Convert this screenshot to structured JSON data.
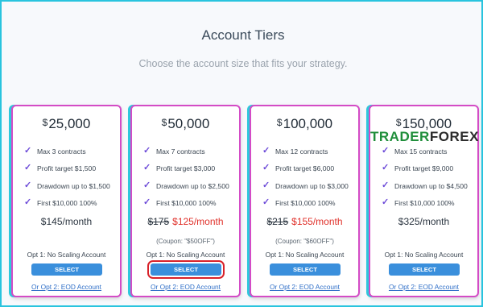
{
  "header": {
    "title": "Account Tiers",
    "subtitle": "Choose the account size that fits your strategy."
  },
  "watermark": {
    "part1": "TRADER",
    "part2": "FOREX"
  },
  "currency_symbol": "$",
  "check_icon": "check-icon",
  "colors": {
    "frame_border": "#29c4de",
    "card_border": "#d44cc6",
    "card_edge": "#2ec8dc",
    "select_button": "#3a8fdc",
    "discount_price": "#e0302a",
    "highlight_ring": "#d8222a",
    "link": "#2f6fc8",
    "check": "#6c4ad8"
  },
  "tiers": [
    {
      "amount": "25,000",
      "features": [
        "Max 3 contracts",
        "Profit target $1,500",
        "Drawdown up to $1,500",
        "First $10,000 100%"
      ],
      "old_price": "",
      "price": "$145/month",
      "coupon": "",
      "opt1": "Opt 1: No Scaling Account",
      "select_label": "SELECT",
      "opt2": "Or Opt 2: EOD Account"
    },
    {
      "amount": "50,000",
      "features": [
        "Max 7 contracts",
        "Profit target $3,000",
        "Drawdown up to $2,500",
        "First $10,000 100%"
      ],
      "old_price": "$175",
      "price": "$125/month",
      "coupon": "(Coupon: \"$50OFF\")",
      "opt1": "Opt 1: No Scaling Account",
      "select_label": "SELECT",
      "opt2": "Or Opt 2: EOD Account"
    },
    {
      "amount": "100,000",
      "features": [
        "Max 12 contracts",
        "Profit target $6,000",
        "Drawdown up to $3,000",
        "First $10,000 100%"
      ],
      "old_price": "$215",
      "price": "$155/month",
      "coupon": "(Coupon: \"$60OFF\")",
      "opt1": "Opt 1: No Scaling Account",
      "select_label": "SELECT",
      "opt2": "Or Opt 2: EOD Account"
    },
    {
      "amount": "150,000",
      "features": [
        "Max 15 contracts",
        "Profit target $9,000",
        "Drawdown up to $4,500",
        "First $10,000 100%"
      ],
      "old_price": "",
      "price": "$325/month",
      "coupon": "",
      "opt1": "Opt 1: No Scaling Account",
      "select_label": "SELECT",
      "opt2": "Or Opt 2: EOD Account"
    }
  ]
}
